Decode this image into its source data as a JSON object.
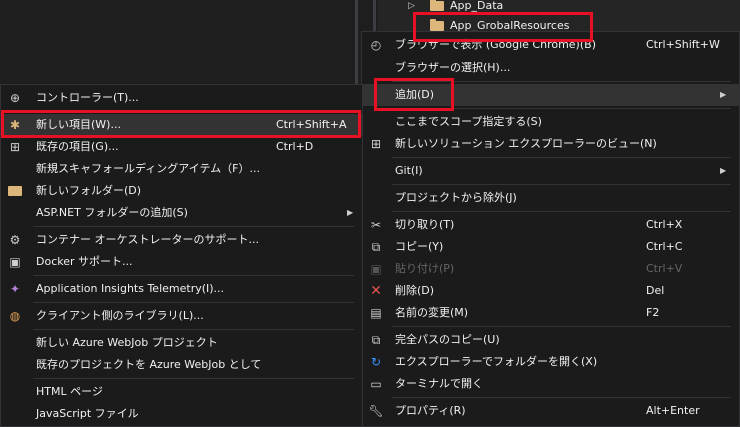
{
  "explorer": {
    "items": [
      {
        "label": "App_Data",
        "expandable": true
      },
      {
        "label": "App_GrobalResources",
        "expandable": false
      }
    ]
  },
  "context_menu": {
    "items": [
      {
        "label": "ブラウザーで表示 (Google Chrome)(B)",
        "shortcut": "Ctrl+Shift+W",
        "icon": "browser-view-icon"
      },
      {
        "label": "ブラウザーの選択(H)...",
        "shortcut": ""
      },
      {
        "label": "追加(D)",
        "submenu": "▶"
      },
      {
        "label": "ここまでスコープ指定する(S)",
        "shortcut": ""
      },
      {
        "label": "新しいソリューション エクスプローラーのビュー(N)",
        "icon": "new-explorer-view-icon"
      },
      {
        "label": "Git(I)",
        "submenu": "▶"
      },
      {
        "label": "プロジェクトから除外(J)"
      },
      {
        "label": "切り取り(T)",
        "shortcut": "Ctrl+X",
        "icon": "scissors-icon"
      },
      {
        "label": "コピー(Y)",
        "shortcut": "Ctrl+C",
        "icon": "copy-icon"
      },
      {
        "label": "貼り付け(P)",
        "shortcut": "Ctrl+V",
        "icon": "paste-icon",
        "disabled": true
      },
      {
        "label": "削除(D)",
        "shortcut": "Del",
        "icon": "delete-icon"
      },
      {
        "label": "名前の変更(M)",
        "shortcut": "F2",
        "icon": "rename-icon"
      },
      {
        "label": "完全パスのコピー(U)",
        "icon": "copy-path-icon"
      },
      {
        "label": "エクスプローラーでフォルダーを開く(X)",
        "icon": "open-folder-icon"
      },
      {
        "label": "ターミナルで開く",
        "icon": "terminal-icon"
      },
      {
        "label": "プロパティ(R)",
        "shortcut": "Alt+Enter",
        "icon": "wrench-icon"
      }
    ]
  },
  "add_submenu": {
    "items": [
      {
        "label": "コントローラー(T)...",
        "icon": "controller-icon"
      },
      {
        "label": "新しい項目(W)...",
        "shortcut": "Ctrl+Shift+A",
        "icon": "new-item-icon"
      },
      {
        "label": "既存の項目(G)...",
        "shortcut": "Ctrl+D",
        "icon": "existing-item-icon"
      },
      {
        "label": "新規スキャフォールディングアイテム（F）..."
      },
      {
        "label": "新しいフォルダー(D)",
        "icon": "new-folder-icon"
      },
      {
        "label": "ASP.NET フォルダーの追加(S)",
        "submenu": "▶"
      },
      {
        "label": "コンテナー オーケストレーターのサポート...",
        "icon": "container-icon"
      },
      {
        "label": "Docker サポート...",
        "icon": "docker-icon"
      },
      {
        "label": "Application Insights Telemetry(I)...",
        "icon": "insights-icon"
      },
      {
        "label": "クライアント側のライブラリ(L)...",
        "icon": "client-library-icon"
      },
      {
        "label": "新しい Azure WebJob プロジェクト"
      },
      {
        "label": "既存のプロジェクトを Azure WebJob として"
      },
      {
        "label": "HTML ページ"
      },
      {
        "label": "JavaScript ファイル"
      }
    ]
  },
  "colors": {
    "highlight_border": "#e81123",
    "menu_bg": "#1b1b1c",
    "folder": "#dcb67a",
    "delete": "#e05252",
    "accent_blue": "#3794ff"
  }
}
